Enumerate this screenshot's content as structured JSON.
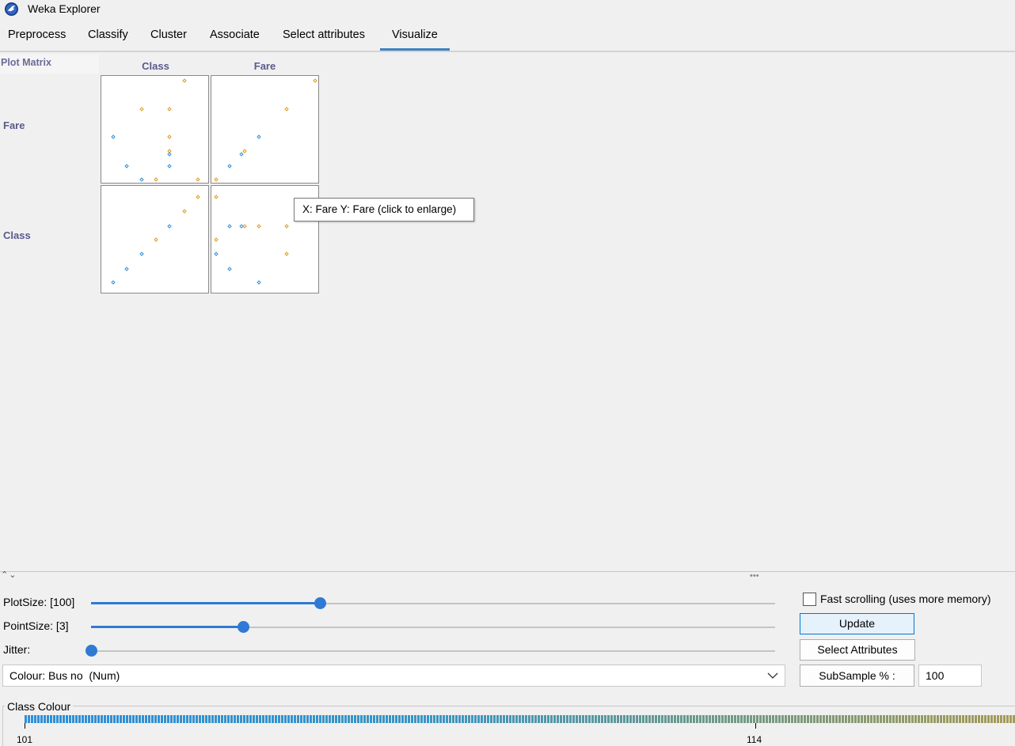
{
  "window": {
    "title": "Weka Explorer",
    "icon": "weka-bird-icon"
  },
  "tabs": [
    {
      "label": "Preprocess",
      "active": false
    },
    {
      "label": "Classify",
      "active": false
    },
    {
      "label": "Cluster",
      "active": false
    },
    {
      "label": "Associate",
      "active": false
    },
    {
      "label": "Select attributes",
      "active": false
    },
    {
      "label": "Visualize",
      "active": true
    }
  ],
  "plot_matrix": {
    "corner_label": "Plot Matrix",
    "column_labels": [
      "Class",
      "Fare"
    ],
    "row_labels": [
      "Fare",
      "Class"
    ],
    "tooltip": "X: Fare Y: Fare (click to enlarge)",
    "point_colors": {
      "low": "#2f8fd8",
      "high": "#e09a1c"
    }
  },
  "controls": {
    "plot_size_label": "PlotSize: [100]",
    "plot_size_fraction": 0.335,
    "point_size_label": "PointSize: [3]",
    "point_size_fraction": 0.222,
    "jitter_label": "Jitter:",
    "jitter_fraction": 0.0,
    "fast_scrolling_label": "Fast scrolling (uses more memory)",
    "fast_scrolling_checked": false,
    "update_label": "Update",
    "select_attributes_label": "Select Attributes",
    "colour_select_value": "Colour: Bus no  (Num)",
    "subsample_label": "SubSample % :",
    "subsample_value": "100"
  },
  "class_colour": {
    "title": "Class Colour",
    "tick_labels": [
      "101",
      "114"
    ]
  },
  "accent_color": "#3e81c2"
}
